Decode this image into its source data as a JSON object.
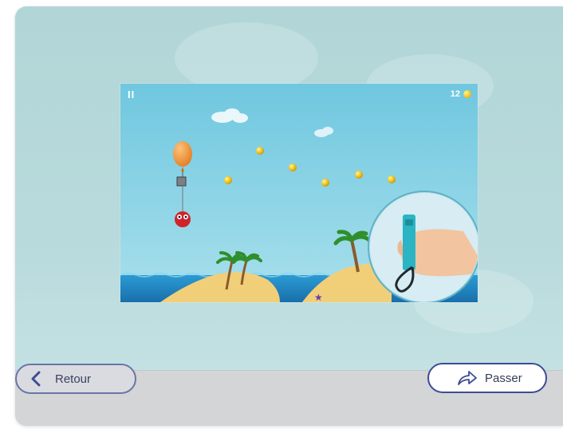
{
  "game": {
    "pause_icon": "II",
    "score": "12",
    "score_icon": "coin-icon",
    "hand_overlay": "hand-holding-controller-icon"
  },
  "nav": {
    "back_label": "Retour",
    "back_icon": "chevron-left-icon",
    "skip_label": "Passer",
    "skip_icon": "share-arrow-icon"
  },
  "colors": {
    "accent": "#3e4c95",
    "sky": "#7ccfe2",
    "sea": "#1f87c5",
    "sand": "#f3d07a",
    "balloon": "#f39a3a",
    "controller": "#2bb4c4"
  }
}
